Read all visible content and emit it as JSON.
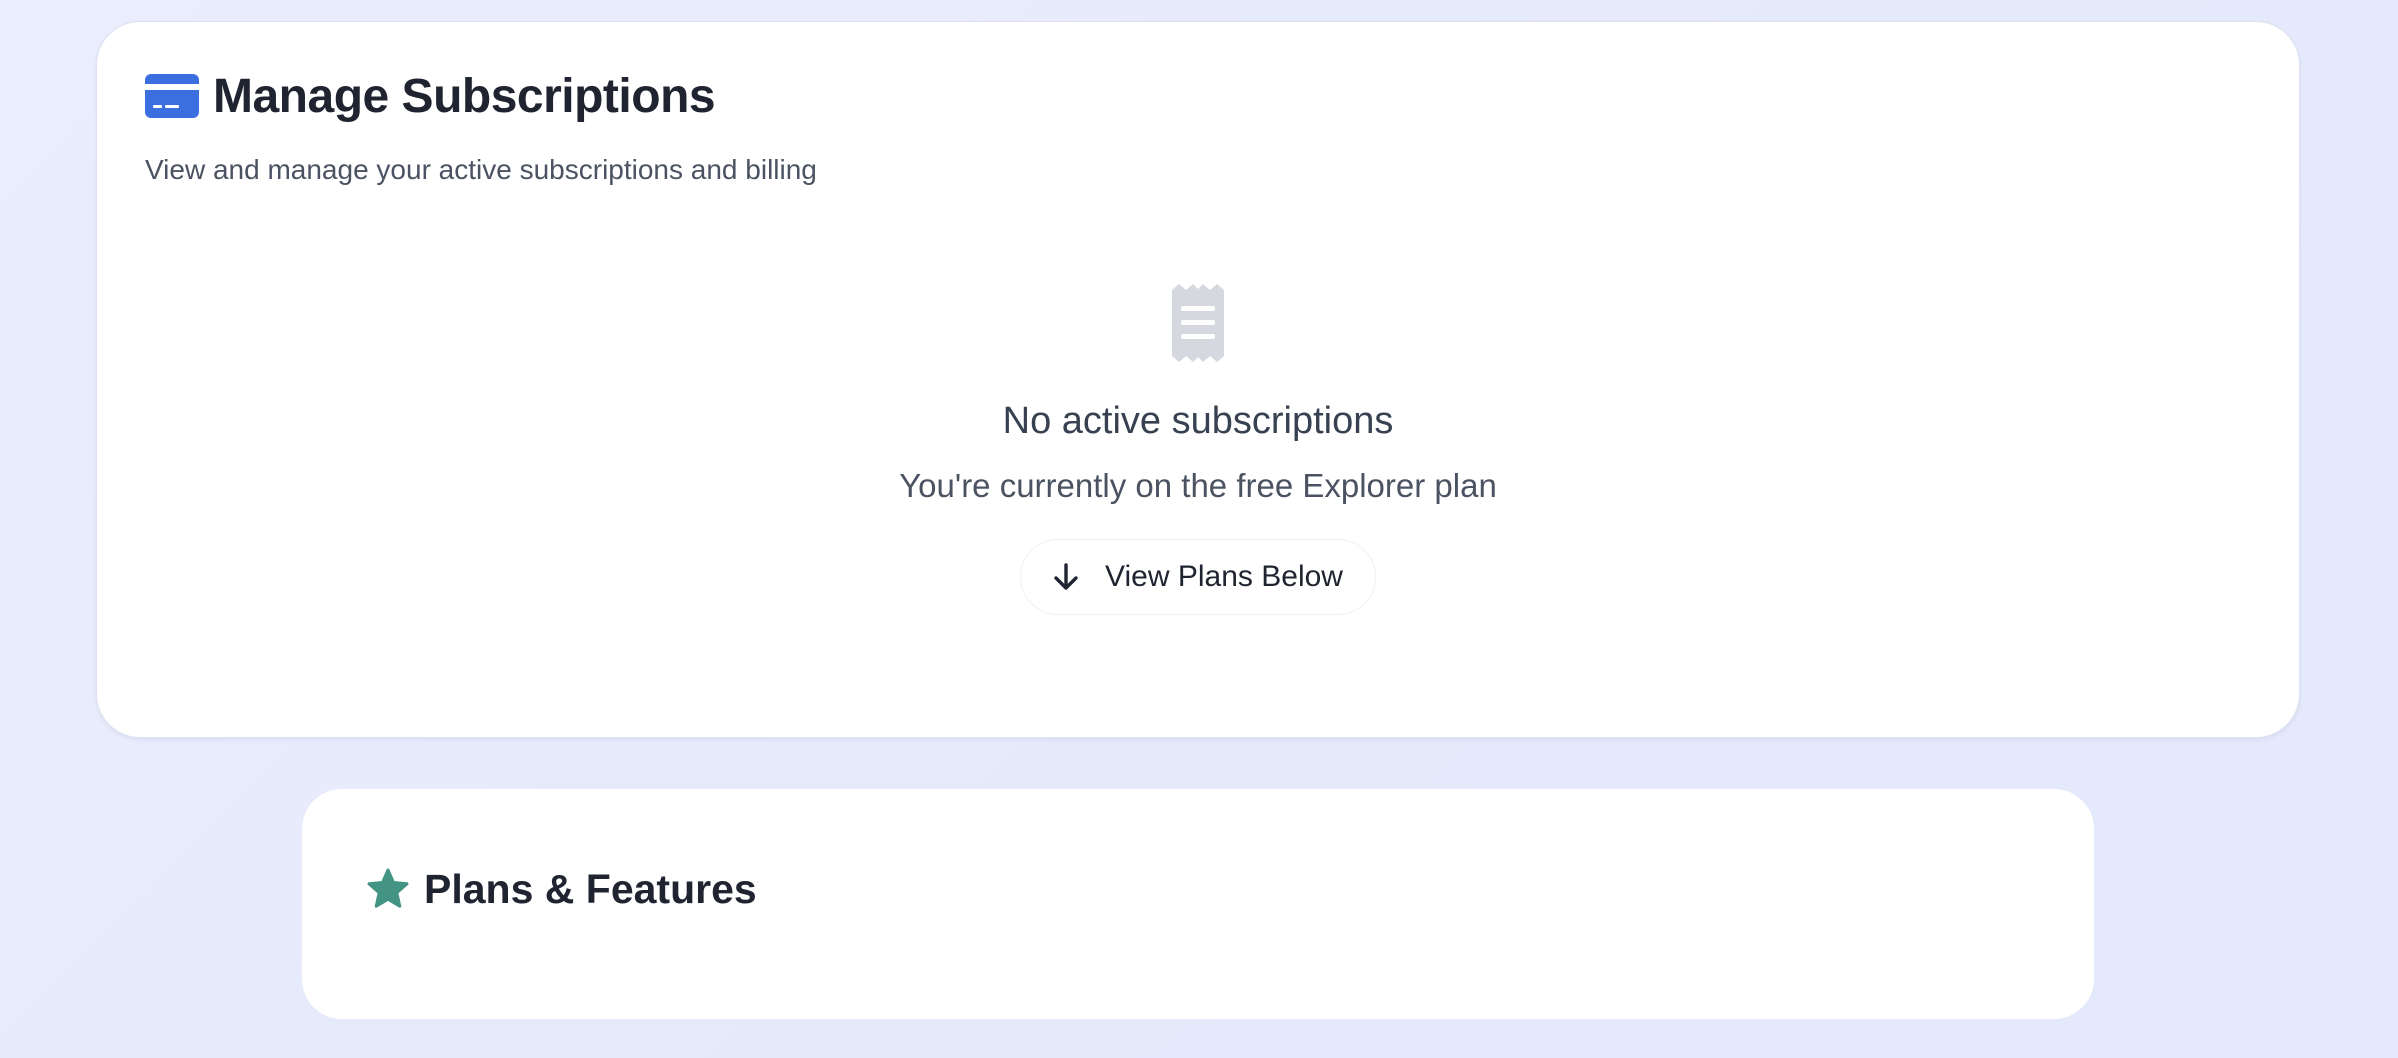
{
  "subscriptions": {
    "icon": "credit-card-icon",
    "title": "Manage Subscriptions",
    "subtitle": "View and manage your active subscriptions and billing",
    "empty_state": {
      "icon": "receipt-icon",
      "title": "No active subscriptions",
      "message": "You're currently on the free Explorer plan",
      "button": {
        "icon": "arrow-down-icon",
        "label": "View Plans Below"
      }
    }
  },
  "plans": {
    "icon": "star-icon",
    "title": "Plans & Features"
  },
  "colors": {
    "accent_blue": "#3b6fe0",
    "accent_teal": "#449485",
    "muted_icon": "#d5d8de",
    "background": "#e6eafb"
  }
}
